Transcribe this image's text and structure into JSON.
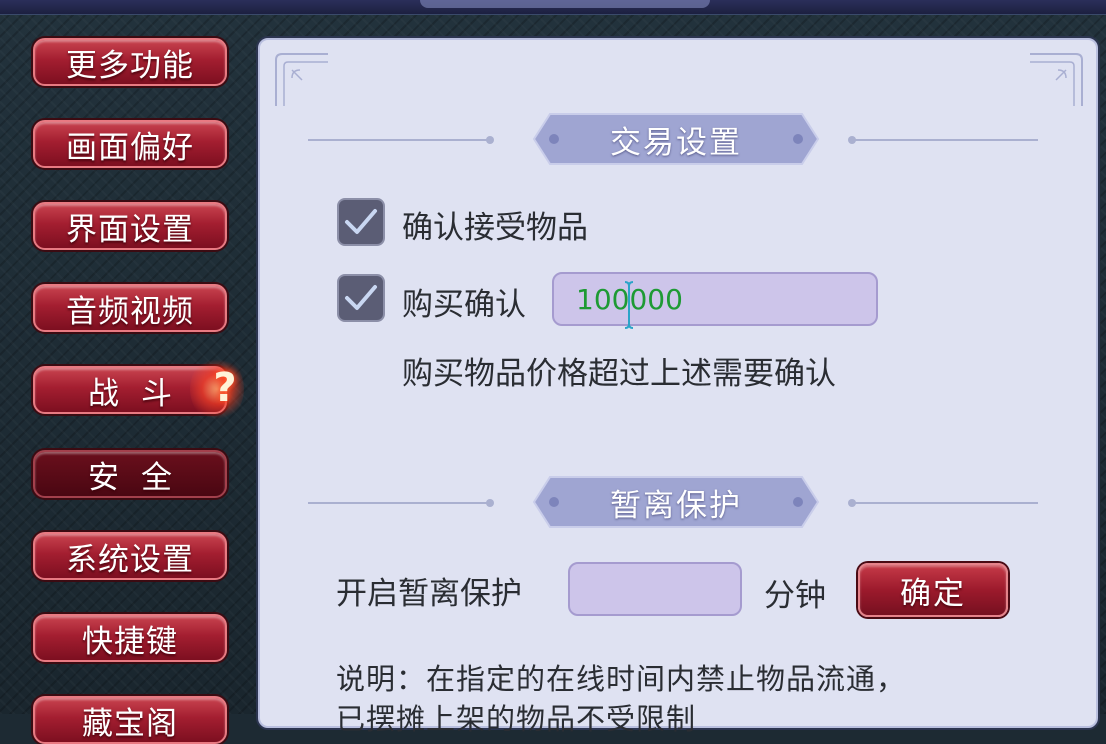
{
  "sidebar": {
    "items": [
      {
        "label": "更多功能",
        "active": false
      },
      {
        "label": "画面偏好",
        "active": false
      },
      {
        "label": "界面设置",
        "active": false
      },
      {
        "label": "音频视频",
        "active": false
      },
      {
        "label": "战斗",
        "active": false,
        "alert": true
      },
      {
        "label": "安全",
        "active": true
      },
      {
        "label": "系统设置",
        "active": false
      },
      {
        "label": "快捷键",
        "active": false
      },
      {
        "label": "藏宝阁",
        "active": false
      }
    ],
    "alert_mark": "?"
  },
  "trade_settings": {
    "title": "交易设置",
    "confirm_receive": {
      "label": "确认接受物品",
      "checked": true
    },
    "purchase_confirm": {
      "label": "购买确认",
      "checked": true,
      "value": "100000"
    },
    "hint": "购买物品价格超过上述需要确认"
  },
  "away_protection": {
    "title": "暂离保护",
    "enable_label": "开启暂离保护",
    "minutes_value": "",
    "unit": "分钟",
    "confirm_button": "确定",
    "note_line1": "说明：在指定的在线时间内禁止物品流通，",
    "note_line2": "已摆摊上架的物品不受限制"
  },
  "colors": {
    "button_red": "#a31e30",
    "panel_bg": "#dfe2f2",
    "header_bg": "#9fa5d2",
    "input_bg": "#cdc5ea",
    "value_green": "#1e9a34"
  }
}
